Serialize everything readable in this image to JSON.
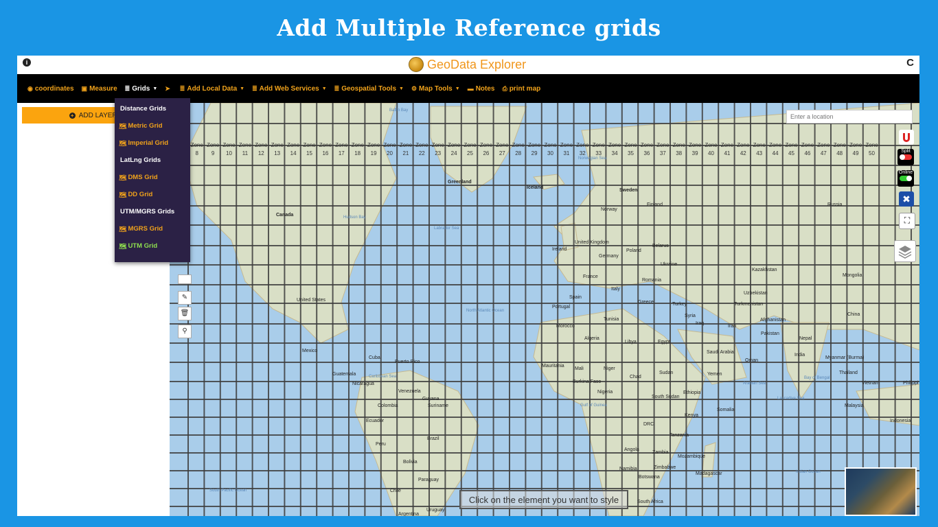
{
  "banner": {
    "title": "Add Multiple Reference grids"
  },
  "app": {
    "logo_text": "GeoData Explorer",
    "info_label": "i",
    "refresh_label": "C"
  },
  "navbar": [
    {
      "label": "coordinates",
      "icon": "globe-icon",
      "glyph": "◉",
      "white": false,
      "caret": false
    },
    {
      "label": "Measure",
      "icon": "ruler-icon",
      "glyph": "▣",
      "white": false,
      "caret": false
    },
    {
      "label": "Grids",
      "icon": "list-icon",
      "glyph": "≣",
      "white": true,
      "caret": true
    },
    {
      "label": "",
      "icon": "location-arrow-icon",
      "glyph": "➤",
      "white": false,
      "caret": false
    },
    {
      "label": "Add Local Data",
      "icon": "database-icon",
      "glyph": "≣",
      "white": false,
      "caret": true
    },
    {
      "label": "Add Web Services",
      "icon": "database-icon",
      "glyph": "≣",
      "white": false,
      "caret": true
    },
    {
      "label": "Geospatial Tools",
      "icon": "database-icon",
      "glyph": "≣",
      "white": false,
      "caret": true
    },
    {
      "label": "Map Tools",
      "icon": "cogs-icon",
      "glyph": "⚙",
      "white": false,
      "caret": true
    },
    {
      "label": "Notes",
      "icon": "note-icon",
      "glyph": "▬",
      "white": false,
      "caret": false
    },
    {
      "label": "print map",
      "icon": "print-icon",
      "glyph": "⎙",
      "white": false,
      "caret": false
    }
  ],
  "sidebar": {
    "add_layers_label": "ADD LAYERS"
  },
  "grids_menu": [
    {
      "type": "header",
      "label": "Distance Grids"
    },
    {
      "type": "item",
      "label": "Metric Grid",
      "icon": "map-icon",
      "active": false
    },
    {
      "type": "item",
      "label": "Imperial Grid",
      "icon": "map-icon",
      "active": false
    },
    {
      "type": "header",
      "label": "LatLng Grids"
    },
    {
      "type": "item",
      "label": "DMS Grid",
      "icon": "map-icon",
      "active": false
    },
    {
      "type": "item",
      "label": "DD Grid",
      "icon": "map-icon",
      "active": false
    },
    {
      "type": "header",
      "label": "UTM/MGRS Grids"
    },
    {
      "type": "item",
      "label": "MGRS Grid",
      "icon": "map-icon",
      "active": false
    },
    {
      "type": "item",
      "label": "UTM Grid",
      "icon": "map-icon",
      "active": true
    }
  ],
  "map": {
    "search_placeholder": "Enter a location",
    "style_hint": "Click on the element you want to style",
    "split_label": "Split",
    "online_label": "Online",
    "zone_label": "Zone",
    "zones": [
      "8",
      "9",
      "10",
      "11",
      "12",
      "13",
      "14",
      "15",
      "16",
      "17",
      "18",
      "19",
      "20",
      "21",
      "22",
      "23",
      "24",
      "25",
      "26",
      "27",
      "28",
      "29",
      "30",
      "31",
      "32",
      "33",
      "34",
      "35",
      "36",
      "37",
      "38",
      "39",
      "40",
      "41",
      "42",
      "43",
      "44",
      "45",
      "46",
      "47",
      "48",
      "49",
      "50"
    ],
    "places": [
      {
        "name": "Greenland",
        "bold": true,
        "sea": false
      },
      {
        "name": "Iceland",
        "bold": true,
        "sea": false
      },
      {
        "name": "Canada",
        "bold": true,
        "sea": false
      },
      {
        "name": "Sweden",
        "bold": true,
        "sea": false
      },
      {
        "name": "Finland",
        "bold": false,
        "sea": false
      },
      {
        "name": "Norway",
        "bold": false,
        "sea": false
      },
      {
        "name": "Russia",
        "bold": false,
        "sea": false
      },
      {
        "name": "United Kingdom",
        "bold": false,
        "sea": false
      },
      {
        "name": "Ireland",
        "bold": false,
        "sea": false
      },
      {
        "name": "Germany",
        "bold": false,
        "sea": false
      },
      {
        "name": "Poland",
        "bold": false,
        "sea": false
      },
      {
        "name": "Belarus",
        "bold": false,
        "sea": false
      },
      {
        "name": "Ukraine",
        "bold": false,
        "sea": false
      },
      {
        "name": "France",
        "bold": false,
        "sea": false
      },
      {
        "name": "Romania",
        "bold": false,
        "sea": false
      },
      {
        "name": "Kazakhstan",
        "bold": false,
        "sea": false
      },
      {
        "name": "Mongolia",
        "bold": false,
        "sea": false
      },
      {
        "name": "Spain",
        "bold": false,
        "sea": false
      },
      {
        "name": "Italy",
        "bold": false,
        "sea": false
      },
      {
        "name": "Portugal",
        "bold": false,
        "sea": false
      },
      {
        "name": "Greece",
        "bold": false,
        "sea": false
      },
      {
        "name": "Turkey",
        "bold": false,
        "sea": false
      },
      {
        "name": "Uzbekistan",
        "bold": false,
        "sea": false
      },
      {
        "name": "Turkmenistan",
        "bold": false,
        "sea": false
      },
      {
        "name": "China",
        "bold": false,
        "sea": false
      },
      {
        "name": "Syria",
        "bold": false,
        "sea": false
      },
      {
        "name": "Iraq",
        "bold": false,
        "sea": false
      },
      {
        "name": "Iran",
        "bold": false,
        "sea": false
      },
      {
        "name": "Afghanistan",
        "bold": false,
        "sea": false
      },
      {
        "name": "Pakistan",
        "bold": false,
        "sea": false
      },
      {
        "name": "Nepal",
        "bold": false,
        "sea": false
      },
      {
        "name": "Morocco",
        "bold": false,
        "sea": false
      },
      {
        "name": "Tunisia",
        "bold": false,
        "sea": false
      },
      {
        "name": "Algeria",
        "bold": false,
        "sea": false
      },
      {
        "name": "Libya",
        "bold": false,
        "sea": false
      },
      {
        "name": "Egypt",
        "bold": false,
        "sea": false
      },
      {
        "name": "Saudi Arabia",
        "bold": false,
        "sea": false
      },
      {
        "name": "Oman",
        "bold": false,
        "sea": false
      },
      {
        "name": "India",
        "bold": false,
        "sea": false
      },
      {
        "name": "Myanmar (Burma)",
        "bold": false,
        "sea": false
      },
      {
        "name": "Thailand",
        "bold": false,
        "sea": false
      },
      {
        "name": "Vietnam",
        "bold": false,
        "sea": false
      },
      {
        "name": "Philippi",
        "bold": false,
        "sea": false
      },
      {
        "name": "Mauritania",
        "bold": false,
        "sea": false
      },
      {
        "name": "Mali",
        "bold": false,
        "sea": false
      },
      {
        "name": "Niger",
        "bold": false,
        "sea": false
      },
      {
        "name": "Chad",
        "bold": false,
        "sea": false
      },
      {
        "name": "Sudan",
        "bold": false,
        "sea": false
      },
      {
        "name": "Yemen",
        "bold": false,
        "sea": false
      },
      {
        "name": "Burkina Faso",
        "bold": false,
        "sea": false
      },
      {
        "name": "Nigeria",
        "bold": false,
        "sea": false
      },
      {
        "name": "Ethiopia",
        "bold": false,
        "sea": false
      },
      {
        "name": "Somalia",
        "bold": false,
        "sea": false
      },
      {
        "name": "South Sudan",
        "bold": false,
        "sea": false
      },
      {
        "name": "Kenya",
        "bold": false,
        "sea": false
      },
      {
        "name": "DRC",
        "bold": false,
        "sea": false
      },
      {
        "name": "Tanzania",
        "bold": false,
        "sea": false
      },
      {
        "name": "Angola",
        "bold": false,
        "sea": false
      },
      {
        "name": "Zambia",
        "bold": false,
        "sea": false
      },
      {
        "name": "Mozambique",
        "bold": false,
        "sea": false
      },
      {
        "name": "Namibia",
        "bold": false,
        "sea": false
      },
      {
        "name": "Zimbabwe",
        "bold": false,
        "sea": false
      },
      {
        "name": "Botswana",
        "bold": false,
        "sea": false
      },
      {
        "name": "Madagascar",
        "bold": false,
        "sea": false
      },
      {
        "name": "South Africa",
        "bold": false,
        "sea": false
      },
      {
        "name": "Malaysia",
        "bold": false,
        "sea": false
      },
      {
        "name": "Indonesia",
        "bold": false,
        "sea": false
      },
      {
        "name": "United States",
        "bold": false,
        "sea": false
      },
      {
        "name": "Mexico",
        "bold": false,
        "sea": false
      },
      {
        "name": "Cuba",
        "bold": false,
        "sea": false
      },
      {
        "name": "Puerto Rico",
        "bold": false,
        "sea": false
      },
      {
        "name": "Guatemala",
        "bold": false,
        "sea": false
      },
      {
        "name": "Nicaragua",
        "bold": false,
        "sea": false
      },
      {
        "name": "Venezuela",
        "bold": false,
        "sea": false
      },
      {
        "name": "Guyana",
        "bold": false,
        "sea": false
      },
      {
        "name": "Suriname",
        "bold": false,
        "sea": false
      },
      {
        "name": "Colombia",
        "bold": false,
        "sea": false
      },
      {
        "name": "Ecuador",
        "bold": false,
        "sea": false
      },
      {
        "name": "Peru",
        "bold": false,
        "sea": false
      },
      {
        "name": "Brazil",
        "bold": false,
        "sea": false
      },
      {
        "name": "Bolivia",
        "bold": false,
        "sea": false
      },
      {
        "name": "Paraguay",
        "bold": false,
        "sea": false
      },
      {
        "name": "Chile",
        "bold": false,
        "sea": false
      },
      {
        "name": "Uruguay",
        "bold": false,
        "sea": false
      },
      {
        "name": "Argentina",
        "bold": false,
        "sea": false
      },
      {
        "name": "North Atlantic Ocean",
        "bold": false,
        "sea": true
      },
      {
        "name": "South Pacific Ocean",
        "bold": false,
        "sea": true
      },
      {
        "name": "Indian Ocean",
        "bold": false,
        "sea": true
      },
      {
        "name": "Hudson Bay",
        "bold": false,
        "sea": true
      },
      {
        "name": "Labrador Sea",
        "bold": false,
        "sea": true
      },
      {
        "name": "Baffin Bay",
        "bold": false,
        "sea": true
      },
      {
        "name": "Norwegian Sea",
        "bold": false,
        "sea": true
      },
      {
        "name": "Caribbean Sea",
        "bold": false,
        "sea": true
      },
      {
        "name": "Gulf of Guinea",
        "bold": false,
        "sea": true
      },
      {
        "name": "Bay of Bengal",
        "bold": false,
        "sea": true
      },
      {
        "name": "Arabian Sea",
        "bold": false,
        "sea": true
      },
      {
        "name": "Laccadive Sea",
        "bold": false,
        "sea": true
      }
    ]
  }
}
